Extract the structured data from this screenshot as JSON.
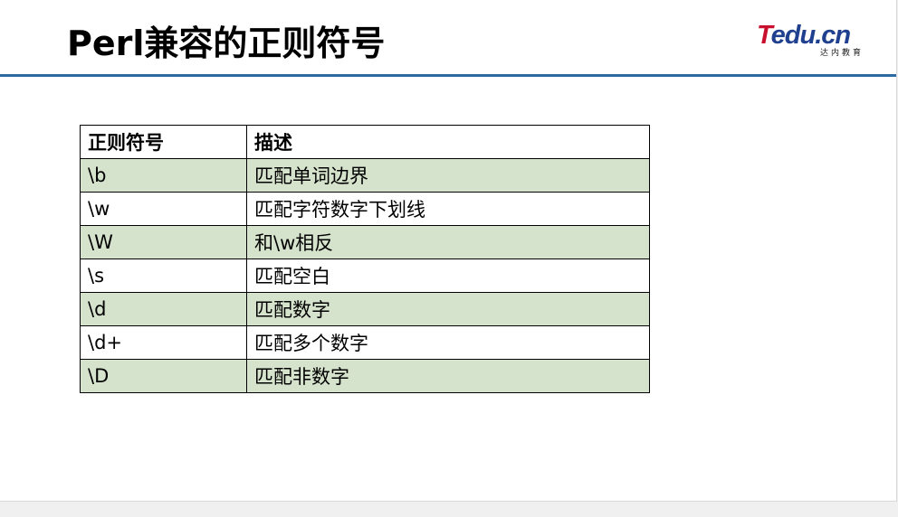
{
  "slide": {
    "title": "Perl兼容的正则符号",
    "accent_color": "#2b6aa3",
    "row_shade_color": "#d6e3cc"
  },
  "logo": {
    "letter": "T",
    "rest": "edu.cn",
    "subtitle": "达内教育"
  },
  "table": {
    "headers": [
      "正则符号",
      "描述"
    ],
    "rows": [
      {
        "symbol": "\\b",
        "description": "匹配单词边界"
      },
      {
        "symbol": "\\w",
        "description": "匹配字符数字下划线"
      },
      {
        "symbol": "\\W",
        "description": "和\\w相反"
      },
      {
        "symbol": "\\s",
        "description": "匹配空白"
      },
      {
        "symbol": "\\d",
        "description": "匹配数字"
      },
      {
        "symbol": "\\d+",
        "description": "匹配多个数字"
      },
      {
        "symbol": "\\D",
        "description": "匹配非数字"
      }
    ]
  }
}
